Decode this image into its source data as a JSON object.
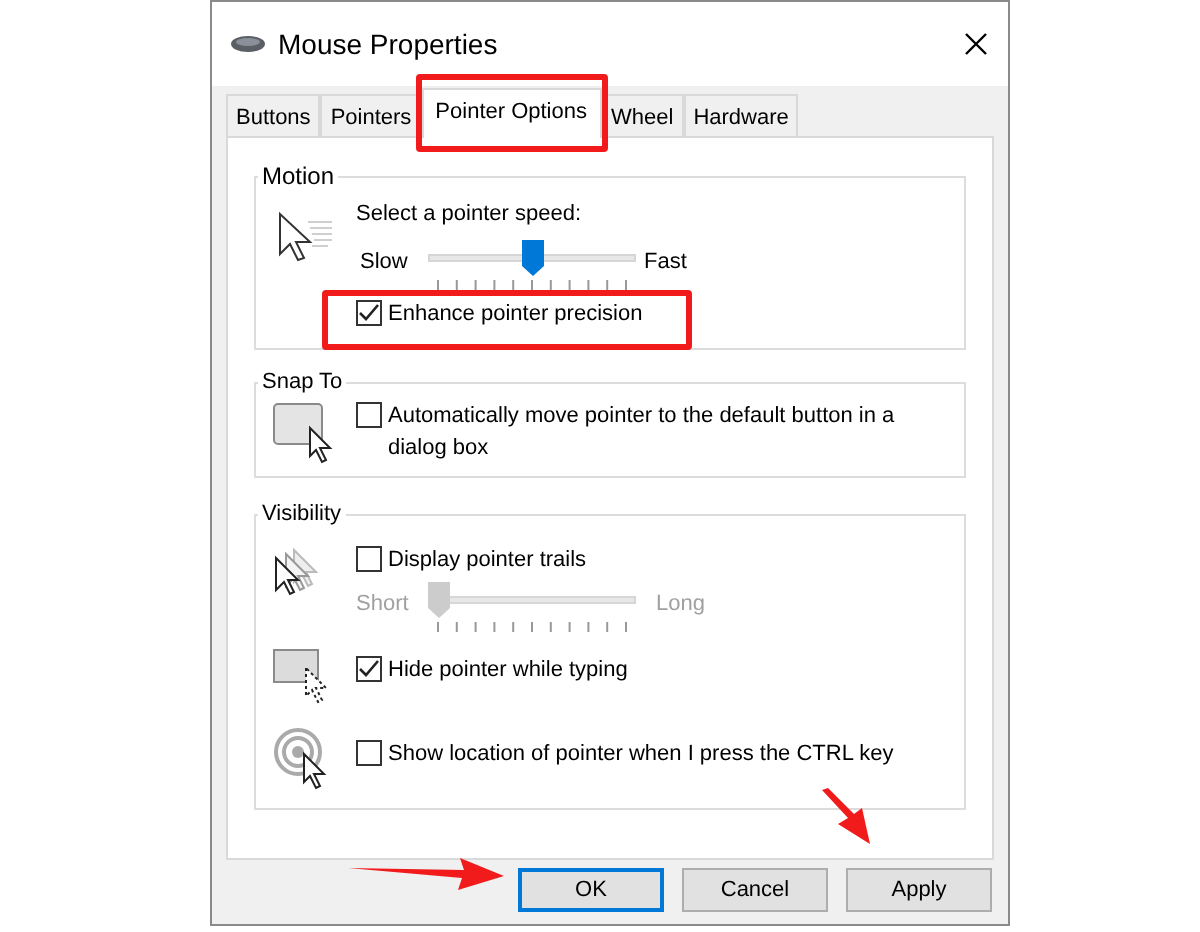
{
  "window": {
    "title": "Mouse Properties"
  },
  "tabs": [
    {
      "label": "Buttons",
      "selected": false
    },
    {
      "label": "Pointers",
      "selected": false
    },
    {
      "label": "Pointer Options",
      "selected": true
    },
    {
      "label": "Wheel",
      "selected": false
    },
    {
      "label": "Hardware",
      "selected": false
    }
  ],
  "motion": {
    "legend": "Motion",
    "speed_label": "Select a pointer speed:",
    "slow": "Slow",
    "fast": "Fast",
    "speed": {
      "level": 0.5
    },
    "enhance": {
      "label": "Enhance pointer precision",
      "checked": true
    }
  },
  "snap_to": {
    "legend": "Snap To",
    "option": {
      "label": "Automatically move pointer to the default button in a dialog box",
      "checked": false
    }
  },
  "visibility": {
    "legend": "Visibility",
    "trails": {
      "label": "Display pointer trails",
      "checked": false
    },
    "trail_length": {
      "short": "Short",
      "long": "Long",
      "level": 0,
      "disabled": true
    },
    "hide": {
      "label": "Hide pointer while typing",
      "checked": true
    },
    "show_location": {
      "label": "Show location of pointer when I press the CTRL key",
      "checked": false
    }
  },
  "buttons": [
    {
      "label": "OK",
      "default": true
    },
    {
      "label": "Cancel",
      "default": false
    },
    {
      "label": "Apply",
      "default": false
    }
  ]
}
